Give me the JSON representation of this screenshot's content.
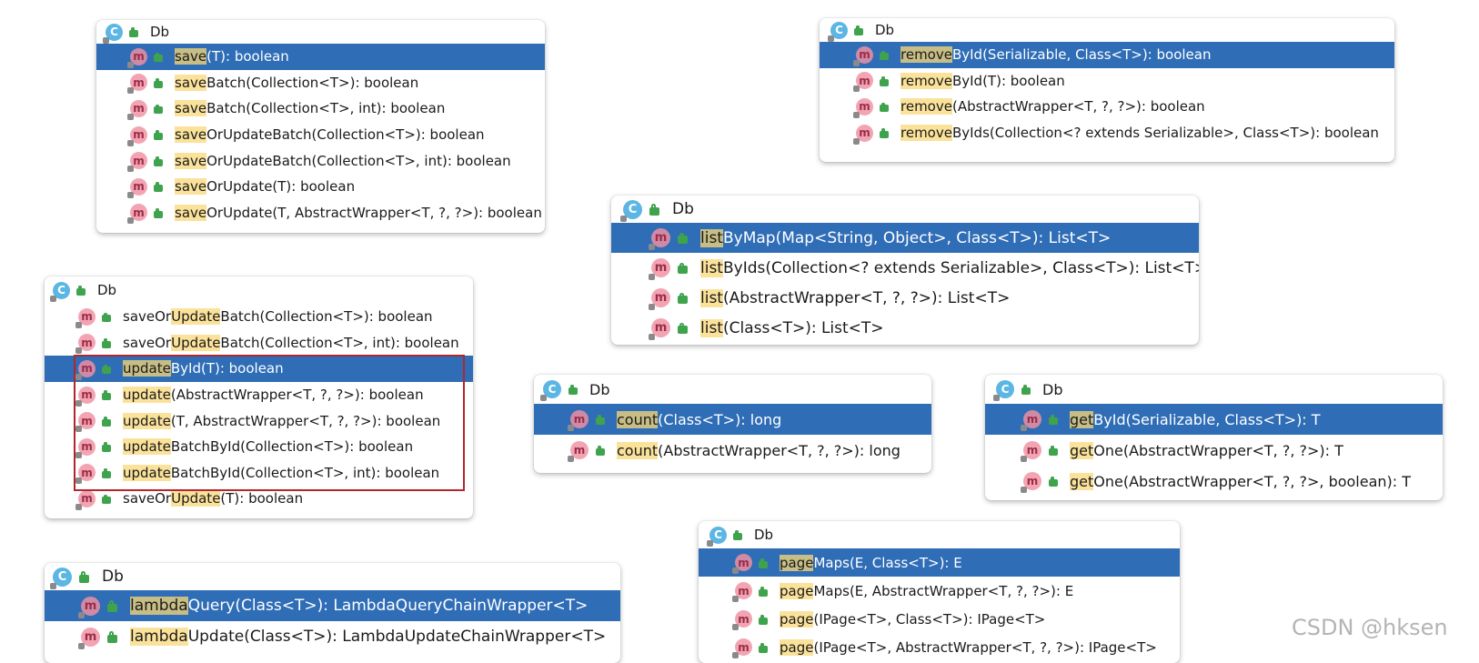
{
  "class_name": "Db",
  "icons": {
    "class": "C",
    "method": "m"
  },
  "save_popup": {
    "items": [
      {
        "hl": "save",
        "rest": "(T): boolean"
      },
      {
        "hl": "save",
        "rest": "Batch(Collection<T>): boolean"
      },
      {
        "hl": "save",
        "rest": "Batch(Collection<T>, int): boolean"
      },
      {
        "hl": "save",
        "rest": "OrUpdateBatch(Collection<T>): boolean"
      },
      {
        "hl": "save",
        "rest": "OrUpdateBatch(Collection<T>, int): boolean"
      },
      {
        "hl": "save",
        "rest": "OrUpdate(T): boolean"
      },
      {
        "hl": "save",
        "rest": "OrUpdate(T, AbstractWrapper<T, ?, ?>): boolean"
      }
    ]
  },
  "remove_popup": {
    "items": [
      {
        "hl": "remove",
        "rest": "ById(Serializable, Class<T>): boolean"
      },
      {
        "hl": "remove",
        "rest": "ById(T): boolean"
      },
      {
        "hl": "remove",
        "rest": "(AbstractWrapper<T, ?, ?>): boolean"
      },
      {
        "hl": "remove",
        "rest": "ByIds(Collection<? extends Serializable>, Class<T>): boolean"
      }
    ]
  },
  "list_popup": {
    "items": [
      {
        "hl": "list",
        "rest": "ByMap(Map<String, Object>, Class<T>): List<T>"
      },
      {
        "hl": "list",
        "rest": "ByIds(Collection<? extends Serializable>, Class<T>): List<T>"
      },
      {
        "hl": "list",
        "rest": "(AbstractWrapper<T, ?, ?>): List<T>"
      },
      {
        "hl": "list",
        "rest": "(Class<T>): List<T>"
      }
    ]
  },
  "update_popup": {
    "items": [
      {
        "pre": "saveOr",
        "hl": "Update",
        "rest": "Batch(Collection<T>): boolean"
      },
      {
        "pre": "saveOr",
        "hl": "Update",
        "rest": "Batch(Collection<T>, int): boolean"
      },
      {
        "pre": "",
        "hl": "update",
        "rest": "ById(T): boolean"
      },
      {
        "pre": "",
        "hl": "update",
        "rest": "(AbstractWrapper<T, ?, ?>): boolean"
      },
      {
        "pre": "",
        "hl": "update",
        "rest": "(T, AbstractWrapper<T, ?, ?>): boolean"
      },
      {
        "pre": "",
        "hl": "update",
        "rest": "BatchById(Collection<T>): boolean"
      },
      {
        "pre": "",
        "hl": "update",
        "rest": "BatchById(Collection<T>, int): boolean"
      },
      {
        "pre": "saveOr",
        "hl": "Update",
        "rest": "(T): boolean"
      }
    ]
  },
  "count_popup": {
    "items": [
      {
        "hl": "count",
        "rest": "(Class<T>): long"
      },
      {
        "hl": "count",
        "rest": "(AbstractWrapper<T, ?, ?>): long"
      }
    ]
  },
  "get_popup": {
    "items": [
      {
        "hl": "get",
        "rest": "ById(Serializable, Class<T>): T"
      },
      {
        "hl": "get",
        "rest": "One(AbstractWrapper<T, ?, ?>): T"
      },
      {
        "hl": "get",
        "rest": "One(AbstractWrapper<T, ?, ?>, boolean): T"
      }
    ]
  },
  "lambda_popup": {
    "items": [
      {
        "hl": "lambda",
        "rest": "Query(Class<T>): LambdaQueryChainWrapper<T>"
      },
      {
        "hl": "lambda",
        "rest": "Update(Class<T>): LambdaUpdateChainWrapper<T>"
      }
    ]
  },
  "page_popup": {
    "items": [
      {
        "hl": "page",
        "rest": "Maps(E, Class<T>): E"
      },
      {
        "hl": "page",
        "rest": "Maps(E, AbstractWrapper<T, ?, ?>): E"
      },
      {
        "hl": "page",
        "rest": "(IPage<T>, Class<T>): IPage<T>"
      },
      {
        "hl": "page",
        "rest": "(IPage<T>, AbstractWrapper<T, ?, ?>): IPage<T>"
      }
    ]
  },
  "watermark": "CSDN @hksen"
}
